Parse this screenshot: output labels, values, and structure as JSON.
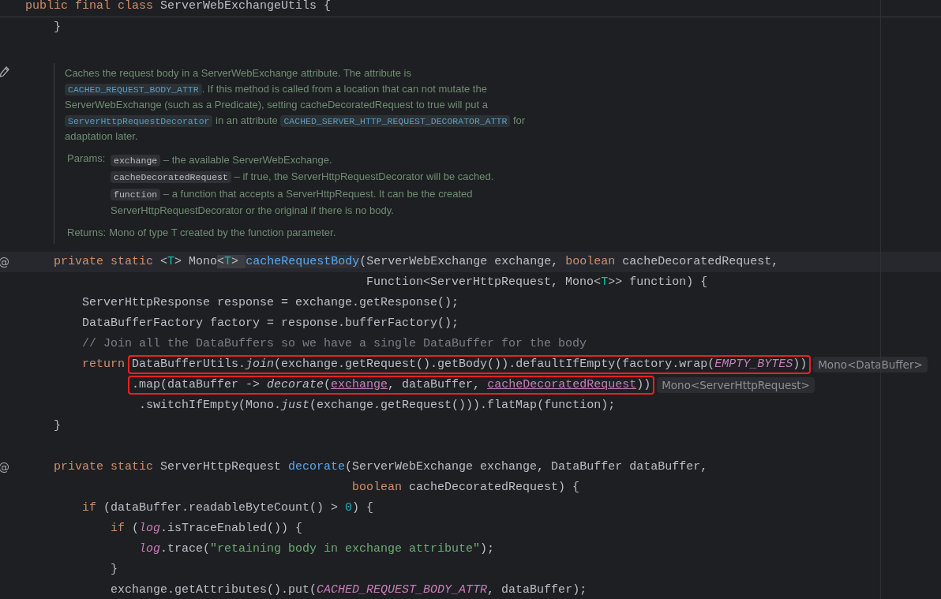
{
  "editor": {
    "rows": [
      {
        "kind": "header",
        "tokens": [
          {
            "text": "public final class ",
            "kind": "kw"
          },
          {
            "text": "ServerWebExchangeUtils {",
            "kind": "plain"
          }
        ]
      },
      {
        "kind": "code",
        "current": false,
        "tokens": [
          {
            "text": "    }",
            "kind": "plain"
          }
        ]
      },
      {
        "kind": "blank"
      },
      {
        "kind": "doc",
        "paragraph": [
          {
            "text": "Caches the request body in a ServerWebExchange attribute. The attribute is ",
            "kind": "text"
          },
          {
            "text": "CACHED_REQUEST_BODY_ATTR",
            "kind": "code"
          },
          {
            "text": ". If this method is called from a location that can not mutate the ServerWebExchange (such as a Predicate), setting cacheDecoratedRequest to true will put a ",
            "kind": "text"
          },
          {
            "text": "ServerHttpRequestDecorator",
            "kind": "code"
          },
          {
            "text": " in an attribute ",
            "kind": "text"
          },
          {
            "text": "CACHED_SERVER_HTTP_REQUEST_DECORATOR_ATTR",
            "kind": "code"
          },
          {
            "text": " for adaptation later.",
            "kind": "text"
          }
        ],
        "params_label": "Params:",
        "params": [
          {
            "name": "exchange",
            "desc": "– the available ServerWebExchange."
          },
          {
            "name": "cacheDecoratedRequest",
            "desc": "– if true, the ServerHttpRequestDecorator will be cached."
          },
          {
            "name": "function",
            "desc": "– a function that accepts a ServerHttpRequest. It can be the created ServerHttpRequestDecorator or the original if there is no body."
          }
        ],
        "returns_label": "Returns:",
        "returns": "Mono of type T created by the function parameter."
      },
      {
        "kind": "code",
        "current": true,
        "gutter": "@",
        "tokens": [
          {
            "text": "    private static ",
            "kind": "kw"
          },
          {
            "text": "<",
            "kind": "plain"
          },
          {
            "text": "T",
            "kind": "tparam"
          },
          {
            "text": "> Mono",
            "kind": "plain"
          },
          {
            "text": "<",
            "kind": "match"
          },
          {
            "text": "T",
            "kind": "tparam-match"
          },
          {
            "text": "> ",
            "kind": "match"
          },
          {
            "text": "cacheRequestBody",
            "kind": "decl-hl"
          },
          {
            "text": "(ServerWebExchange exchange, ",
            "kind": "plain"
          },
          {
            "text": "boolean",
            "kind": "kw"
          },
          {
            "text": " cacheDecoratedRequest,",
            "kind": "plain"
          }
        ]
      },
      {
        "kind": "code",
        "current": false,
        "tokens": [
          {
            "text": "                                                Function<ServerHttpRequest, Mono<",
            "kind": "plain"
          },
          {
            "text": "T",
            "kind": "tparam"
          },
          {
            "text": ">> function) {",
            "kind": "plain"
          }
        ]
      },
      {
        "kind": "code",
        "current": false,
        "tokens": [
          {
            "text": "        ServerHttpResponse response = exchange.getResponse();",
            "kind": "plain"
          }
        ]
      },
      {
        "kind": "code",
        "current": false,
        "tokens": [
          {
            "text": "        DataBufferFactory factory = response.bufferFactory();",
            "kind": "plain"
          }
        ]
      },
      {
        "kind": "code",
        "current": false,
        "tokens": [
          {
            "text": "        // Join all the DataBuffers so we have a single DataBuffer for the body",
            "kind": "comment"
          }
        ]
      },
      {
        "kind": "code",
        "current": false,
        "tokens": [
          {
            "text": "        return ",
            "kind": "kw"
          }
        ],
        "marked": [
          {
            "text": "DataBufferUtils.",
            "kind": "plain"
          },
          {
            "text": "join",
            "kind": "italic"
          },
          {
            "text": "(exchange.getRequest().getBody()).defaultIfEmpty(factory.wrap(",
            "kind": "plain"
          },
          {
            "text": "EMPTY_BYTES",
            "kind": "const"
          },
          {
            "text": "))",
            "kind": "plain"
          }
        ],
        "hint": "Mono<DataBuffer>"
      },
      {
        "kind": "chain",
        "current": false,
        "marked": [
          {
            "text": ".map(dataBuffer -> ",
            "kind": "plain"
          },
          {
            "text": "decorate",
            "kind": "italic"
          },
          {
            "text": "(",
            "kind": "plain"
          },
          {
            "text": "exchange",
            "kind": "ref"
          },
          {
            "text": ", dataBuffer, ",
            "kind": "plain"
          },
          {
            "text": "cacheDecoratedRequest",
            "kind": "ref"
          },
          {
            "text": "))",
            "kind": "plain"
          }
        ],
        "hint": "Mono<ServerHttpRequest>"
      },
      {
        "kind": "code",
        "current": false,
        "tokens": [
          {
            "text": "                .switchIfEmpty(Mono.",
            "kind": "plain"
          },
          {
            "text": "just",
            "kind": "italic"
          },
          {
            "text": "(exchange.getRequest())).flatMap(function);",
            "kind": "plain"
          }
        ]
      },
      {
        "kind": "code",
        "current": false,
        "tokens": [
          {
            "text": "    }",
            "kind": "plain"
          }
        ]
      },
      {
        "kind": "blank"
      },
      {
        "kind": "code",
        "current": false,
        "gutter": "@",
        "tokens": [
          {
            "text": "    private static ",
            "kind": "kw"
          },
          {
            "text": "ServerHttpRequest ",
            "kind": "plain"
          },
          {
            "text": "decorate",
            "kind": "decl"
          },
          {
            "text": "(ServerWebExchange exchange, DataBuffer dataBuffer,",
            "kind": "plain"
          }
        ]
      },
      {
        "kind": "code",
        "current": false,
        "tokens": [
          {
            "text": "                                              boolean",
            "kind": "kw"
          },
          {
            "text": " cacheDecoratedRequest) {",
            "kind": "plain"
          }
        ]
      },
      {
        "kind": "code",
        "current": false,
        "tokens": [
          {
            "text": "        if ",
            "kind": "kw"
          },
          {
            "text": "(dataBuffer.readableByteCount() > ",
            "kind": "plain"
          },
          {
            "text": "0",
            "kind": "num"
          },
          {
            "text": ") {",
            "kind": "plain"
          }
        ]
      },
      {
        "kind": "code",
        "current": false,
        "tokens": [
          {
            "text": "            if ",
            "kind": "kw"
          },
          {
            "text": "(",
            "kind": "plain"
          },
          {
            "text": "log",
            "kind": "field"
          },
          {
            "text": ".isTraceEnabled()) {",
            "kind": "plain"
          }
        ]
      },
      {
        "kind": "code",
        "current": false,
        "tokens": [
          {
            "text": "                log",
            "kind": "field"
          },
          {
            "text": ".trace(",
            "kind": "plain"
          },
          {
            "text": "\"retaining body in exchange attribute\"",
            "kind": "string"
          },
          {
            "text": ");",
            "kind": "plain"
          }
        ]
      },
      {
        "kind": "code",
        "current": false,
        "tokens": [
          {
            "text": "            }",
            "kind": "plain"
          }
        ]
      },
      {
        "kind": "code",
        "current": false,
        "tokens": [
          {
            "text": "            exchange.getAttributes().put(",
            "kind": "plain"
          },
          {
            "text": "CACHED_REQUEST_BODY_ATTR",
            "kind": "const"
          },
          {
            "text": ", dataBuffer);",
            "kind": "plain"
          }
        ]
      }
    ]
  }
}
